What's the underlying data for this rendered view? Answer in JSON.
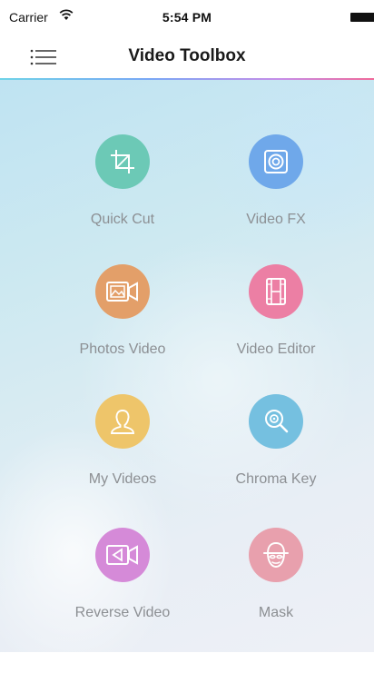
{
  "status_bar": {
    "carrier": "Carrier",
    "time": "5:54 PM"
  },
  "nav": {
    "title": "Video Toolbox",
    "menu_icon": "hamburger-menu-icon"
  },
  "tools": [
    {
      "label": "Quick Cut",
      "icon": "crop-icon",
      "color": "#6cc9b6"
    },
    {
      "label": "Video FX",
      "icon": "speaker-icon",
      "color": "#6fa8ea"
    },
    {
      "label": "Photos Video",
      "icon": "photo-video-icon",
      "color": "#e39f69"
    },
    {
      "label": "Video Editor",
      "icon": "film-strip-icon",
      "color": "#ec7fa4"
    },
    {
      "label": "My Videos",
      "icon": "person-icon",
      "color": "#eec56a"
    },
    {
      "label": "Chroma Key",
      "icon": "magnifier-icon",
      "color": "#75c0e0"
    },
    {
      "label": "Reverse Video",
      "icon": "reverse-camera-icon",
      "color": "#d58ad8"
    },
    {
      "label": "Mask",
      "icon": "mask-icon",
      "color": "#e8a0ad"
    }
  ],
  "colors": {
    "accent_line": [
      "#6fd3e8",
      "#7aa8f5",
      "#c68ee8",
      "#f06a9a"
    ],
    "label_text": "#8c8f93"
  }
}
